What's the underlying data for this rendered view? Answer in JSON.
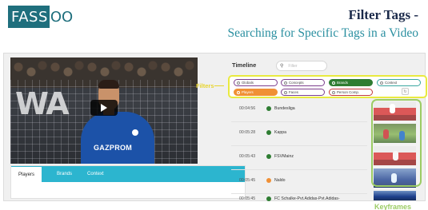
{
  "logo": {
    "part1": "FASS",
    "part2": "OO"
  },
  "slide": {
    "title": "Filter Tags -",
    "subtitle": "Searching for Specific Tags in a Video"
  },
  "video": {
    "adboard_text": "WA",
    "jersey_sponsor": "GAZPROM",
    "play_icon": "play-icon"
  },
  "tabs": [
    {
      "label": "Players",
      "active": true
    },
    {
      "label": "Brands",
      "active": false
    },
    {
      "label": "Context",
      "active": false
    }
  ],
  "timeline": {
    "label": "Timeline",
    "search_placeholder": "Filter",
    "search_icon": "search-icon"
  },
  "filters": {
    "callout": "Filters",
    "chips": [
      {
        "label": "Globals",
        "style": "purple"
      },
      {
        "label": "Concepts",
        "style": "purple"
      },
      {
        "label": "Brands",
        "style": "green-solid"
      },
      {
        "label": "Context",
        "style": "teal"
      },
      {
        "label": "Players",
        "style": "orange-solid"
      },
      {
        "label": "Faces",
        "style": "purple"
      },
      {
        "label": "Person Comp.",
        "style": "red"
      }
    ],
    "refresh_icon": "refresh-icon"
  },
  "timeline_rows": [
    {
      "time": "00:04:56",
      "name": "Bundesliga",
      "color": "#2e7d32"
    },
    {
      "time": "00:05:28",
      "name": "Kappa",
      "color": "#2e7d32"
    },
    {
      "time": "00:05:43",
      "name": "FSVMainz",
      "color": "#2e7d32"
    },
    {
      "time": "00:05:45",
      "name": "Naldo",
      "color": "#f09035"
    },
    {
      "time": "00:05:45",
      "name": "FC Schalke-Pvt.Adidas-Pvt.Adidas-",
      "color": "#2e7d32"
    }
  ],
  "keyframes": {
    "label": "Keyframes"
  },
  "colors": {
    "brand_teal": "#1f6f7d",
    "tab_bar": "#2cb5cf",
    "filters_highlight": "#e9ea3f",
    "keyframes_highlight": "#9ccc65"
  }
}
